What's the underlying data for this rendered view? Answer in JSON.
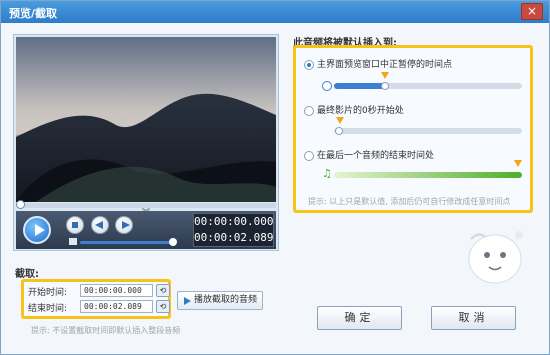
{
  "window": {
    "title": "预览/截取",
    "close_label": "×"
  },
  "player": {
    "current_time": "00:00:00.000",
    "total_time": "00:00:02.089",
    "seek_progress": 0.0,
    "volume_level": 0.95,
    "seek_toggle": "︾"
  },
  "clip": {
    "section_label": "截取:",
    "start_label": "开始时间:",
    "start_value": "00:00:00.000",
    "end_label": "结束时间:",
    "end_value": "00:00:02.089",
    "play_label": "播放截取的音频",
    "hint": "提示: 不设置截取时间即默认插入整段音频"
  },
  "insert": {
    "title": "此音频将被默认插入到:",
    "options": [
      {
        "label": "主界面预览窗口中正暂停的时间点",
        "selected": true
      },
      {
        "label": "最终影片的0秒开始处",
        "selected": false
      },
      {
        "label": "在最后一个音频的结束时间处",
        "selected": false
      }
    ],
    "tip": "提示: 以上只是默认值, 添加后仍可自行修改成任意时间点"
  },
  "buttons": {
    "ok": "确定",
    "cancel": "取消"
  },
  "colors": {
    "accent": "#2f7cc8",
    "highlight": "#f7c31a",
    "green": "#4fae2a"
  }
}
